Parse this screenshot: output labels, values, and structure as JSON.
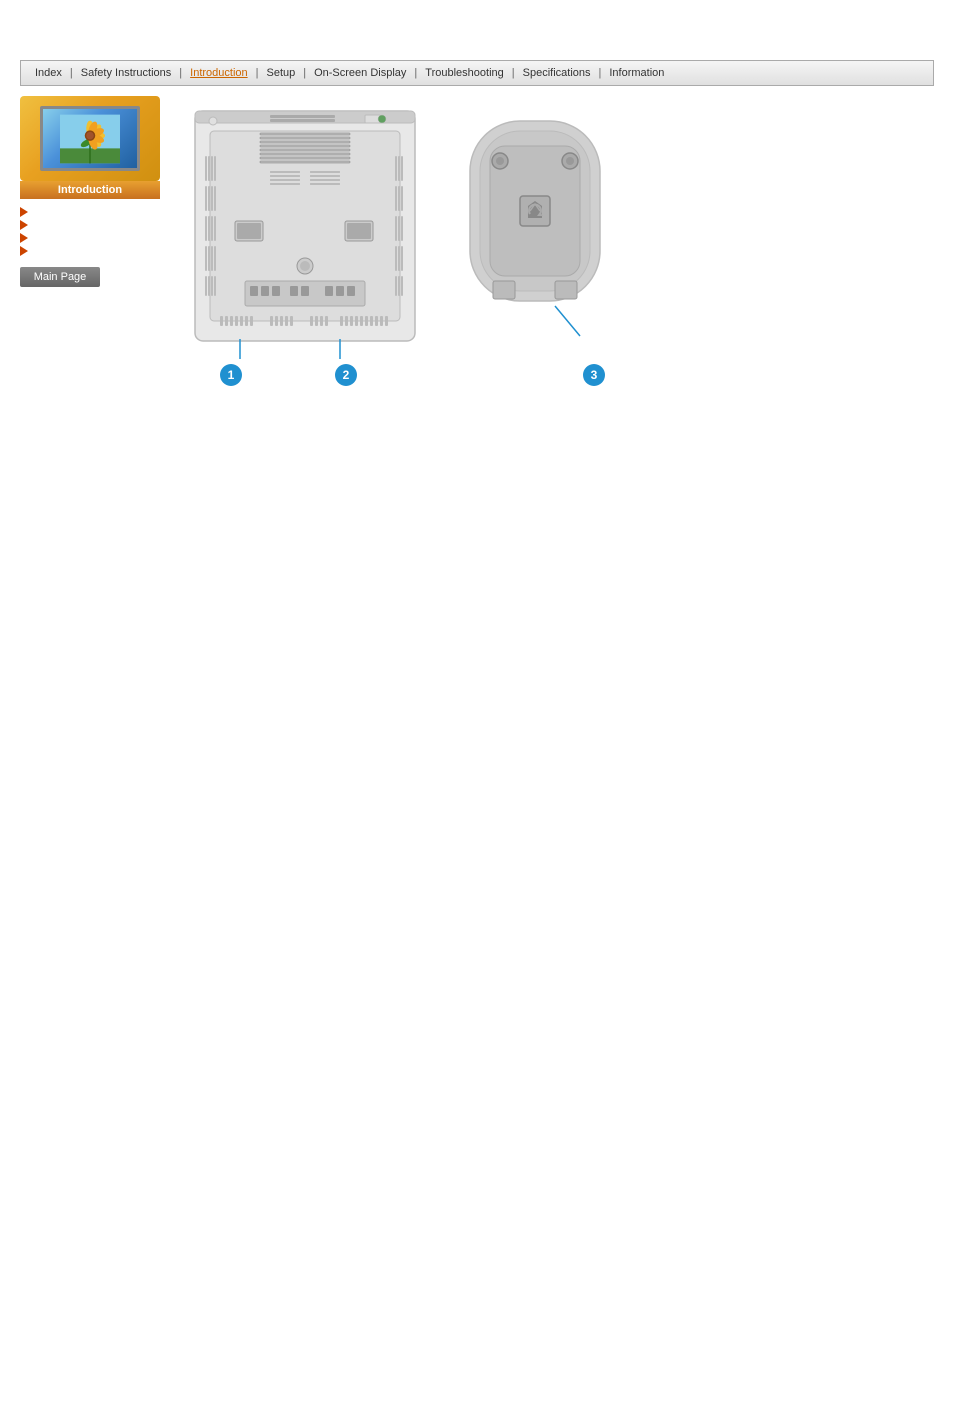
{
  "navbar": {
    "items": [
      {
        "label": "Index",
        "active": false
      },
      {
        "label": "Safety Instructions",
        "active": false
      },
      {
        "label": "Introduction",
        "active": true
      },
      {
        "label": "Setup",
        "active": false
      },
      {
        "label": "On-Screen Display",
        "active": false
      },
      {
        "label": "Troubleshooting",
        "active": false
      },
      {
        "label": "Specifications",
        "active": false
      },
      {
        "label": "Information",
        "active": false
      }
    ]
  },
  "sidebar": {
    "intro_label": "Introduction",
    "arrow_items": [
      {
        "label": ""
      },
      {
        "label": ""
      },
      {
        "label": ""
      },
      {
        "label": ""
      }
    ],
    "main_page_btn": "Main Page"
  },
  "callouts": {
    "c1": "1",
    "c2": "2",
    "c3": "3"
  }
}
